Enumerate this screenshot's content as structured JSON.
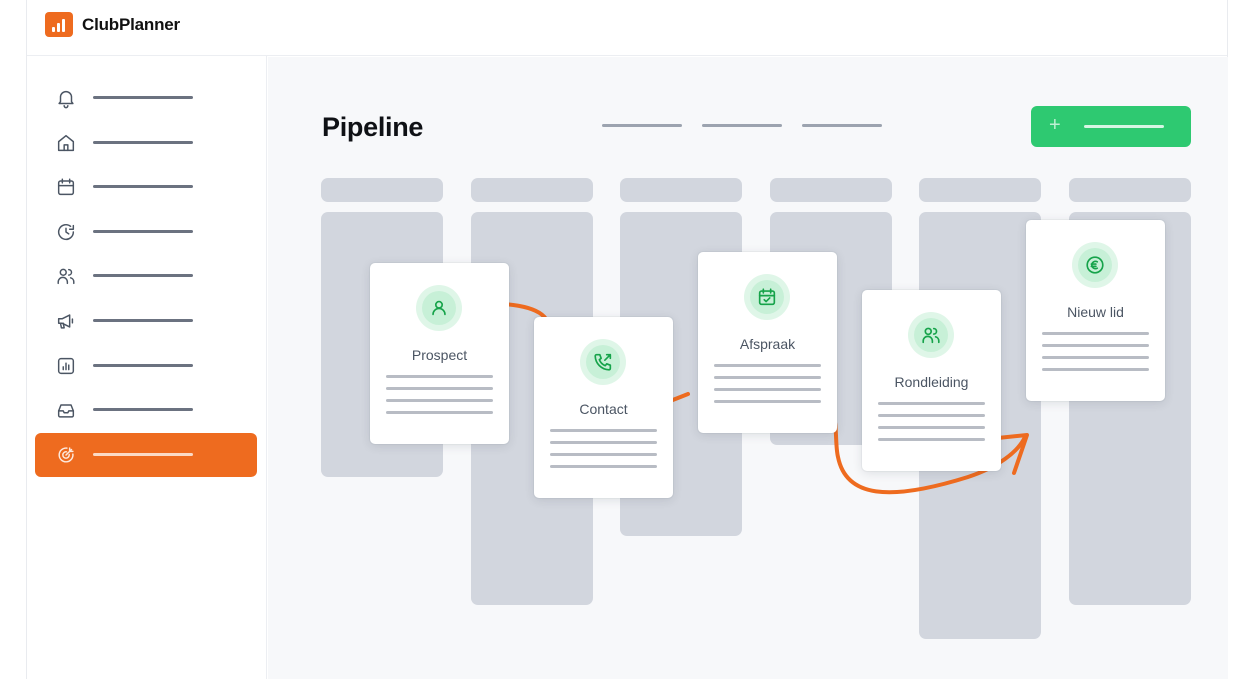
{
  "app": {
    "name": "ClubPlanner"
  },
  "page": {
    "title": "Pipeline"
  },
  "toolbar": {
    "add_symbol": "+"
  },
  "sidebar": {
    "items": [
      {
        "icon": "bell-icon"
      },
      {
        "icon": "home-icon"
      },
      {
        "icon": "calendar-icon"
      },
      {
        "icon": "clock-refresh-icon"
      },
      {
        "icon": "users-icon"
      },
      {
        "icon": "megaphone-icon"
      },
      {
        "icon": "chart-icon"
      },
      {
        "icon": "inbox-icon"
      },
      {
        "icon": "target-icon",
        "active": true
      }
    ]
  },
  "pipeline": {
    "stages": [
      {
        "label": "Prospect",
        "icon": "user-icon"
      },
      {
        "label": "Contact",
        "icon": "phone-outgoing-icon"
      },
      {
        "label": "Afspraak",
        "icon": "calendar-check-icon"
      },
      {
        "label": "Rondleiding",
        "icon": "users-icon"
      },
      {
        "label": "Nieuw lid",
        "icon": "euro-icon"
      }
    ]
  },
  "colors": {
    "accent": "#ee6b1f",
    "success": "#2ec971",
    "icon_green": "#16a34a",
    "column": "#d2d6de"
  }
}
